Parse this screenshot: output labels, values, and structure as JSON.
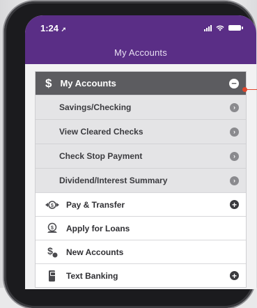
{
  "status_bar": {
    "time": "1:24"
  },
  "nav": {
    "title": "My Accounts"
  },
  "menu": {
    "section": {
      "label": "My Accounts",
      "icon": "dollar-icon",
      "toggle": "minus-circle-icon"
    },
    "sub_items": [
      {
        "label": "Savings/Checking"
      },
      {
        "label": "View Cleared Checks"
      },
      {
        "label": "Check Stop Payment"
      },
      {
        "label": "Dividend/Interest Summary"
      }
    ],
    "items": [
      {
        "label": "Pay & Transfer",
        "icon": "money-transfer-icon",
        "expandable": true
      },
      {
        "label": "Apply for Loans",
        "icon": "loan-coin-icon",
        "expandable": false
      },
      {
        "label": "New Accounts",
        "icon": "dollar-coin-icon",
        "expandable": false
      },
      {
        "label": "Text Banking",
        "icon": "phone-text-icon",
        "expandable": true
      }
    ]
  },
  "colors": {
    "brand": "#5a2e86",
    "header": "#5c5c60",
    "annotation": "#e0462c"
  }
}
